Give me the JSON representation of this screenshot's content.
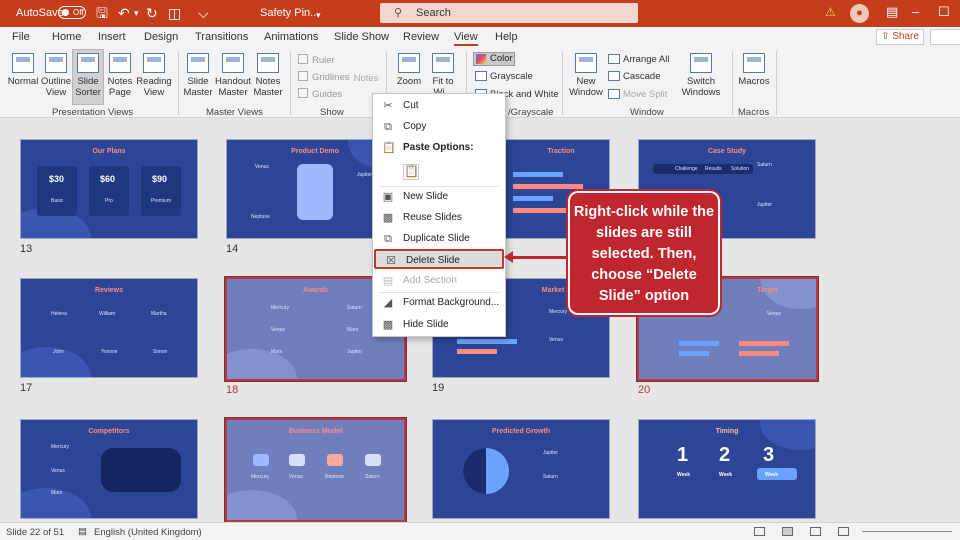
{
  "titlebar": {
    "autosave_label": "AutoSave",
    "autosave_state": "Off",
    "doc_title": "Safety Pin...",
    "search_placeholder": "Search"
  },
  "menu": {
    "items": [
      "File",
      "Home",
      "Insert",
      "Design",
      "Transitions",
      "Animations",
      "Slide Show",
      "Review",
      "View",
      "Help"
    ],
    "active": "View",
    "share_label": "Share"
  },
  "ribbon": {
    "buttons": {
      "normal": "Normal",
      "outline_view": "Outline View",
      "slide_sorter": "Slide Sorter",
      "notes_page": "Notes Page",
      "reading_view": "Reading View",
      "slide_master": "Slide Master",
      "handout_master": "Handout Master",
      "notes_master": "Notes Master",
      "notes": "Notes",
      "zoom": "Zoom",
      "fit_to_window": "Fit to Wi...",
      "color": "Color",
      "grayscale": "Grayscale",
      "black_white": "Black and White",
      "new_window": "New Window",
      "arrange_all": "Arrange All",
      "cascade": "Cascade",
      "move_split": "Move Split",
      "switch_windows": "Switch Windows",
      "macros": "Macros"
    },
    "checkboxes": {
      "ruler": "Ruler",
      "gridlines": "Gridlines",
      "guides": "Guides"
    },
    "groups": {
      "presentation_views": "Presentation Views",
      "master_views": "Master Views",
      "show": "Show",
      "color_grayscale": "/Grayscale",
      "window": "Window",
      "macros": "Macros"
    }
  },
  "context_menu": {
    "cut": "Cut",
    "copy": "Copy",
    "paste_options": "Paste Options:",
    "new_slide": "New Slide",
    "reuse_slides": "Reuse Slides",
    "duplicate_slide": "Duplicate Slide",
    "delete_slide": "Delete Slide",
    "add_section": "Add Section",
    "format_background": "Format Background...",
    "hide_slide": "Hide Slide"
  },
  "callout": {
    "text": "Right-click while the slides are still selected. Then, choose “Delete Slide” option"
  },
  "slides": {
    "s13": {
      "title": "Our Plans",
      "p1": "$30",
      "p2": "$60",
      "p3": "$90",
      "l1": "Basic",
      "l2": "Pro",
      "l3": "Premium",
      "number": "13"
    },
    "s14": {
      "title": "Product Demo",
      "t1": "Venus",
      "t2": "Jupiter",
      "t3": "Neptune",
      "number": "14"
    },
    "s15": {
      "title": "Traction"
    },
    "s16": {
      "title": "Case Study",
      "t1": "Saturn",
      "t2": "Jupiter",
      "h1": "Challenge",
      "h2": "Results",
      "h3": "Solution"
    },
    "s17": {
      "title": "Reviews",
      "n1": "Helena",
      "n2": "William",
      "n3": "Martha",
      "n4": "John",
      "n5": "Yvonne",
      "n6": "Simon",
      "number": "17"
    },
    "s18": {
      "title": "Awards",
      "a1": "Mercury",
      "a2": "Saturn",
      "a3": "Venus",
      "a4": "Mars",
      "a5": "Mars",
      "a6": "Jupiter",
      "number": "18"
    },
    "s19": {
      "title": "Market Size",
      "t1": "Mercury",
      "t2": "Venus",
      "number": "19"
    },
    "s20": {
      "title": "Target",
      "t1": "Venus",
      "number": "20"
    },
    "s21": {
      "title": "Competitors",
      "t1": "Mercury",
      "t2": "Venus",
      "t3": "Mars"
    },
    "s22": {
      "title": "Business Model",
      "t1": "Mercury",
      "t2": "Venus",
      "t3": "Neptune",
      "t4": "Saturn"
    },
    "s23": {
      "title": "Predicted Growth",
      "t1": "Jupiter",
      "t2": "Saturn"
    },
    "s24": {
      "title": "Timing",
      "w1": "Week",
      "w2": "Week",
      "w3": "Week",
      "d1": "1",
      "d2": "2",
      "d3": "3"
    }
  },
  "statusbar": {
    "slide_info": "Slide 22 of 51",
    "language": "English (United Kingdom)"
  }
}
